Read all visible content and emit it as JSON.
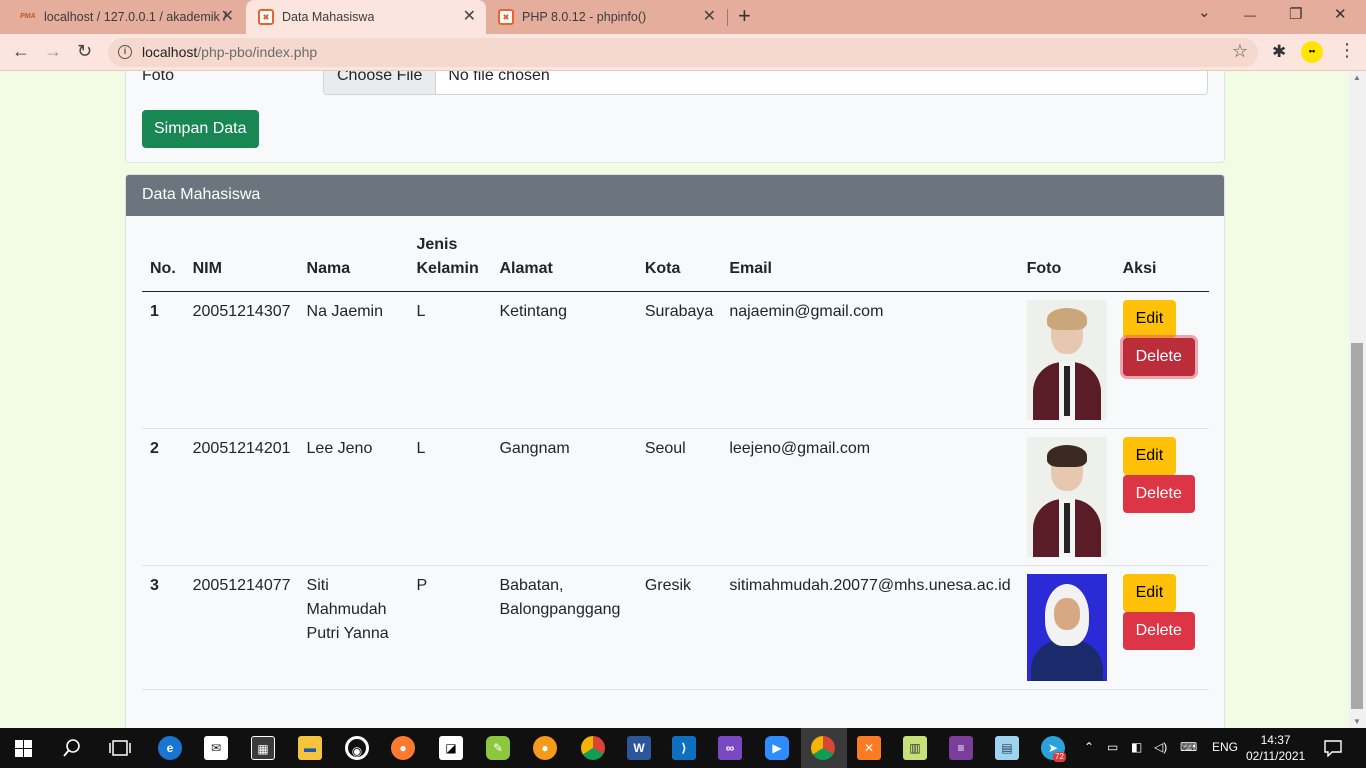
{
  "browser": {
    "tabs": [
      {
        "title": "localhost / 127.0.0.1 / akademik /",
        "close": "✕",
        "icon": "phpmyadmin-icon",
        "icon_text": "PMA"
      },
      {
        "title": "Data Mahasiswa",
        "close": "✕",
        "icon": "xampp-icon",
        "active": true
      },
      {
        "title": "PHP 8.0.12 - phpinfo()",
        "close": "✕",
        "icon": "xampp-icon"
      }
    ],
    "new_tab": "+",
    "window_controls": {
      "dropdown": "⌄",
      "minimize": "—",
      "restore": "❐",
      "close": "✕"
    },
    "nav": {
      "back": "←",
      "forward": "→",
      "reload": "↻"
    },
    "url_host": "localhost",
    "url_path": "/php-pbo/index.php",
    "info_glyph": "i",
    "star": "☆",
    "extensions_icon": "puzzle-icon",
    "extensions_glyph": "✱",
    "profile_glyph": "••",
    "menu_glyph": "⋮"
  },
  "form": {
    "foto_label": "Foto",
    "file_button": "Choose File",
    "file_status": "No file chosen",
    "save_button": "Simpan Data"
  },
  "table_card": {
    "header": "Data Mahasiswa",
    "columns": {
      "no": "No.",
      "nim": "NIM",
      "nama": "Nama",
      "jenis_kelamin_1": "Jenis",
      "jenis_kelamin_2": "Kelamin",
      "alamat": "Alamat",
      "kota": "Kota",
      "email": "Email",
      "foto": "Foto",
      "aksi": "Aksi"
    },
    "rows": [
      {
        "no": "1",
        "nim": "20051214307",
        "nama": "Na Jaemin",
        "jk": "L",
        "alamat": "Ketintang",
        "kota": "Surabaya",
        "email": "najaemin@gmail.com",
        "edit": "Edit",
        "delete": "Delete"
      },
      {
        "no": "2",
        "nim": "20051214201",
        "nama": "Lee Jeno",
        "jk": "L",
        "alamat": "Gangnam",
        "kota": "Seoul",
        "email": "leejeno@gmail.com",
        "edit": "Edit",
        "delete": "Delete"
      },
      {
        "no": "3",
        "nim": "20051214077",
        "nama_1": "Siti",
        "nama_2": "Mahmudah",
        "nama_3": "Putri Yanna",
        "jk": "P",
        "alamat_1": "Babatan,",
        "alamat_2": "Balongpanggang",
        "kota": "Gresik",
        "email": "sitimahmudah.20077@mhs.unesa.ac.id",
        "edit": "Edit",
        "delete": "Delete"
      }
    ]
  },
  "taskbar": {
    "language": "ENG",
    "time": "14:37",
    "date": "02/11/2021",
    "telegram_badge": "72",
    "apps": [
      "windows-start-icon",
      "search-icon",
      "task-view-icon",
      "edge-icon",
      "mail-icon",
      "store-icon",
      "file-explorer-icon",
      "obs-icon",
      "firefox-icon",
      "sticky-notes-icon",
      "notepadpp-icon",
      "app-orange-icon",
      "chrome-icon",
      "word-icon",
      "vscode-icon",
      "visual-studio-icon",
      "zoom-icon",
      "chrome-profile-icon",
      "xampp-icon",
      "app-chart-icon",
      "winrar-icon",
      "app-blue-icon",
      "telegram-icon"
    ]
  },
  "colors": {
    "tab_strip": "#e5ad9c",
    "page_bg": "#f2fce4",
    "save_green": "#198754",
    "edit_yellow": "#ffc107",
    "delete_red": "#dc3545",
    "card_header": "#6c757d"
  }
}
